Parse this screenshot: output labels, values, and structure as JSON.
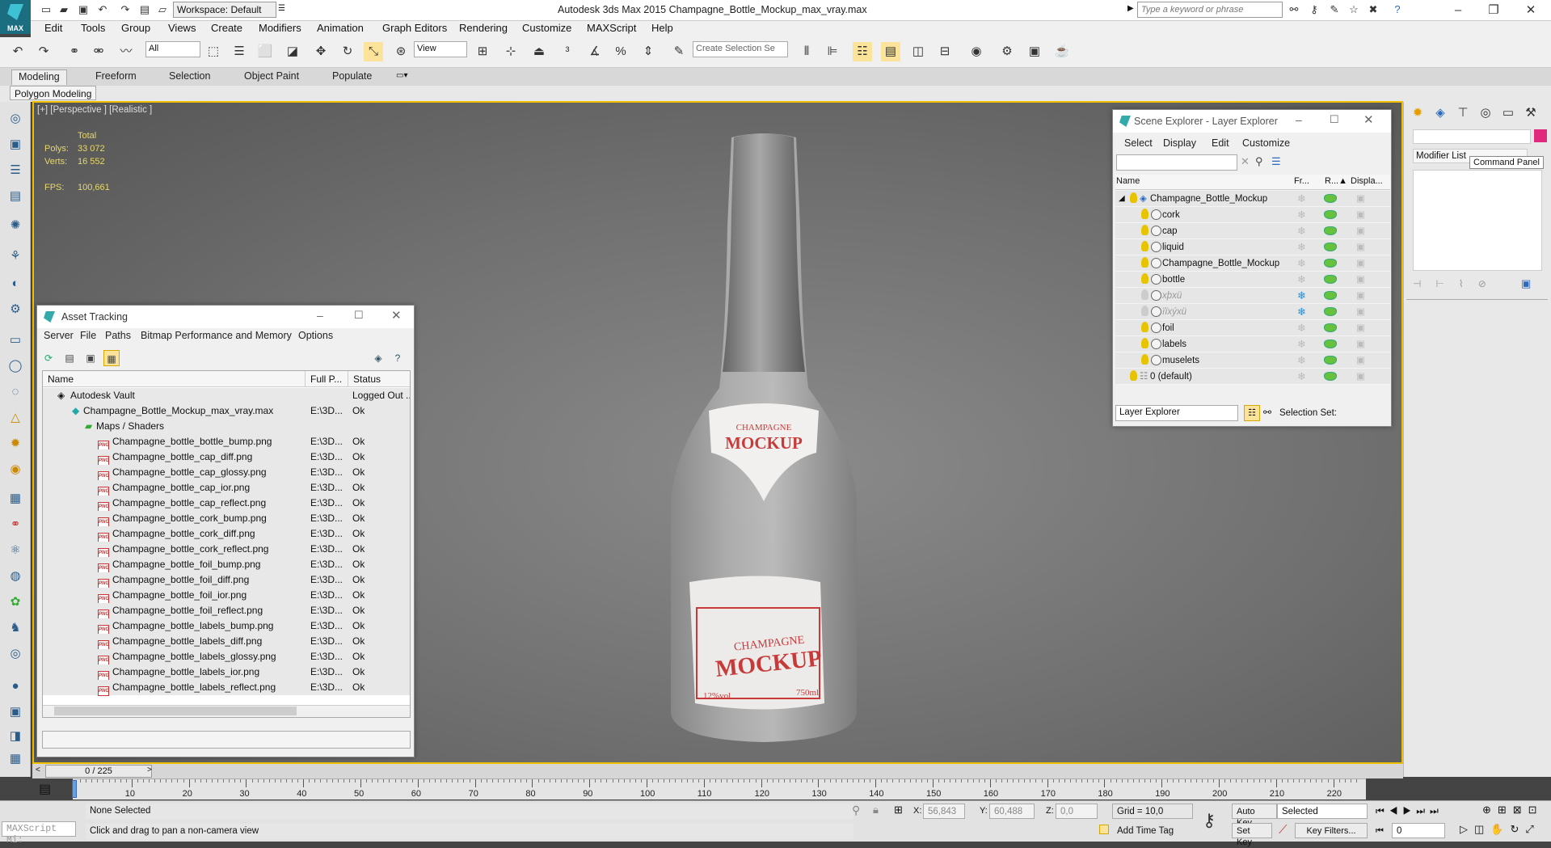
{
  "app": {
    "window_title": "Autodesk 3ds Max 2015    Champagne_Bottle_Mockup_max_vray.max",
    "logo_text": "MAX",
    "workspace": "Workspace: Default",
    "search_placeholder": "Type a keyword or phrase"
  },
  "menu": [
    "Edit",
    "Tools",
    "Group",
    "Views",
    "Create",
    "Modifiers",
    "Animation",
    "Graph Editors",
    "Rendering",
    "Customize",
    "MAXScript",
    "Help"
  ],
  "toolbar": {
    "selection_filter": "All",
    "ref_coord": "View",
    "named_selection": "Create Selection Se"
  },
  "ribbon": {
    "tabs": [
      "Modeling",
      "Freeform",
      "Selection",
      "Object Paint",
      "Populate"
    ],
    "active": "Modeling",
    "panel": "Polygon Modeling"
  },
  "viewport": {
    "label": "[+] [Perspective ] [Realistic ]",
    "stats": {
      "total_label": "Total",
      "polys_label": "Polys:",
      "polys": "33 072",
      "verts_label": "Verts:",
      "verts": "16 552",
      "fps_label": "FPS:",
      "fps": "100,661"
    },
    "label_neck": {
      "line1": "CHAMPAGNE",
      "line2": "MOCKUP"
    },
    "label_body": {
      "line1": "CHAMPAGNE",
      "line2": "MOCKUP",
      "abv": "12%vol",
      "volume": "750ml"
    }
  },
  "asset_tracking": {
    "title": "Asset Tracking",
    "menus": [
      "Server",
      "File",
      "Paths",
      "Bitmap Performance and Memory",
      "Options"
    ],
    "columns": [
      "Name",
      "Full P...",
      "Status"
    ],
    "vault": {
      "name": "Autodesk Vault",
      "status": "Logged Out ..."
    },
    "scene_file": {
      "name": "Champagne_Bottle_Mockup_max_vray.max",
      "path": "E:\\3D...",
      "status": "Ok"
    },
    "maps_group": "Maps / Shaders",
    "files": [
      {
        "name": "Champagne_bottle_bottle_bump.png",
        "path": "E:\\3D...",
        "status": "Ok"
      },
      {
        "name": "Champagne_bottle_cap_diff.png",
        "path": "E:\\3D...",
        "status": "Ok"
      },
      {
        "name": "Champagne_bottle_cap_glossy.png",
        "path": "E:\\3D...",
        "status": "Ok"
      },
      {
        "name": "Champagne_bottle_cap_ior.png",
        "path": "E:\\3D...",
        "status": "Ok"
      },
      {
        "name": "Champagne_bottle_cap_reflect.png",
        "path": "E:\\3D...",
        "status": "Ok"
      },
      {
        "name": "Champagne_bottle_cork_bump.png",
        "path": "E:\\3D...",
        "status": "Ok"
      },
      {
        "name": "Champagne_bottle_cork_diff.png",
        "path": "E:\\3D...",
        "status": "Ok"
      },
      {
        "name": "Champagne_bottle_cork_reflect.png",
        "path": "E:\\3D...",
        "status": "Ok"
      },
      {
        "name": "Champagne_bottle_foil_bump.png",
        "path": "E:\\3D...",
        "status": "Ok"
      },
      {
        "name": "Champagne_bottle_foil_diff.png",
        "path": "E:\\3D...",
        "status": "Ok"
      },
      {
        "name": "Champagne_bottle_foil_ior.png",
        "path": "E:\\3D...",
        "status": "Ok"
      },
      {
        "name": "Champagne_bottle_foil_reflect.png",
        "path": "E:\\3D...",
        "status": "Ok"
      },
      {
        "name": "Champagne_bottle_labels_bump.png",
        "path": "E:\\3D...",
        "status": "Ok"
      },
      {
        "name": "Champagne_bottle_labels_diff.png",
        "path": "E:\\3D...",
        "status": "Ok"
      },
      {
        "name": "Champagne_bottle_labels_glossy.png",
        "path": "E:\\3D...",
        "status": "Ok"
      },
      {
        "name": "Champagne_bottle_labels_ior.png",
        "path": "E:\\3D...",
        "status": "Ok"
      },
      {
        "name": "Champagne_bottle_labels_reflect.png",
        "path": "E:\\3D...",
        "status": "Ok"
      }
    ]
  },
  "scene_explorer": {
    "title": "Scene Explorer - Layer Explorer",
    "menus": [
      "Select",
      "Display",
      "Edit",
      "Customize"
    ],
    "columns": [
      "Name",
      "Fr...",
      "R...▲",
      "Displa..."
    ],
    "root": "Champagne_Bottle_Mockup",
    "items": [
      "cork",
      "cap",
      "liquid",
      "Champagne_Bottle_Mockup",
      "bottle",
      "хþхü",
      "ïïхýхü",
      "foil",
      "labels",
      "muselets"
    ],
    "default_layer": "0 (default)",
    "footer_dropdown": "Layer Explorer",
    "selection_set": "Selection Set:"
  },
  "command_panel": {
    "modifier_list": "Modifier List",
    "tooltip": "Command Panel"
  },
  "timeline": {
    "frame": "0 / 225",
    "ticks": [
      "0",
      "10",
      "20",
      "30",
      "40",
      "50",
      "60",
      "70",
      "80",
      "90",
      "100",
      "110",
      "120",
      "130",
      "140",
      "150",
      "160",
      "170",
      "180",
      "190",
      "200",
      "210",
      "220"
    ]
  },
  "status": {
    "maxscript": "MAXScript Mi:",
    "selection": "None Selected",
    "prompt": "Click and drag to pan a non-camera view",
    "x_label": "X:",
    "x": "56,843",
    "y_label": "Y:",
    "y": "60,488",
    "z_label": "Z:",
    "z": "0,0",
    "grid": "Grid = 10,0",
    "add_time_tag": "Add Time Tag",
    "auto_key": "Auto Key",
    "set_key": "Set Key",
    "key_mode": "Selected",
    "key_filters": "Key Filters...",
    "current_frame": "0"
  }
}
